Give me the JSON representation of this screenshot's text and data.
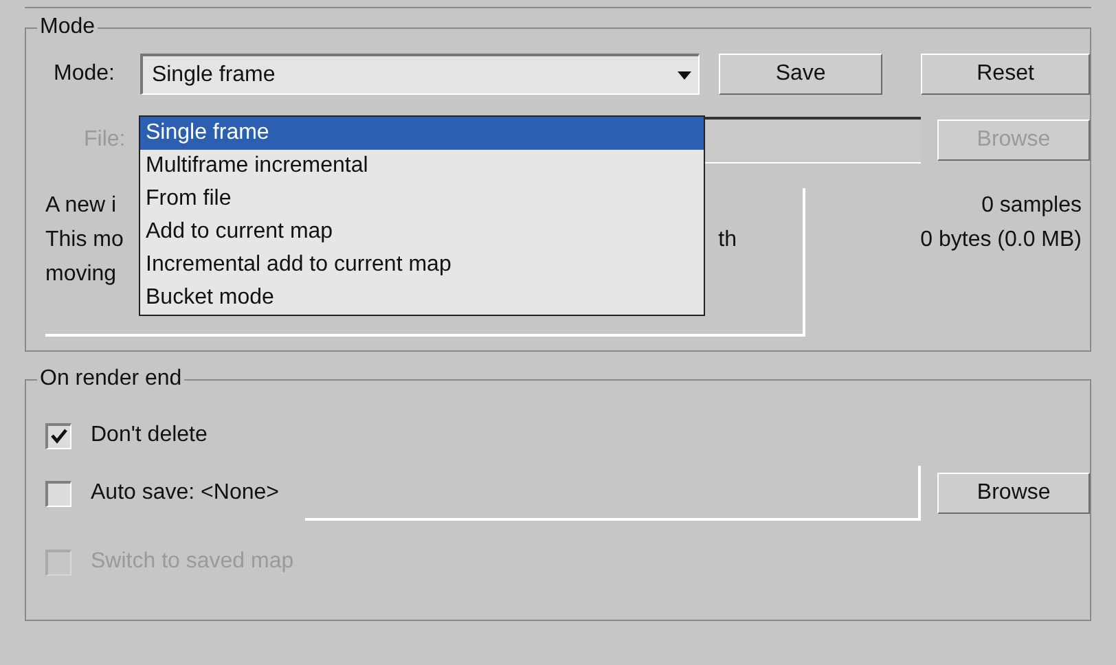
{
  "mode_group": {
    "title": "Mode",
    "mode_label": "Mode:",
    "mode_value": "Single frame",
    "save_button": "Save",
    "reset_button": "Reset",
    "file_label": "File:",
    "file_disabled": true,
    "browse_button": "Browse",
    "browse_disabled": true,
    "dropdown": {
      "options": [
        {
          "label": "Single frame",
          "selected": true
        },
        {
          "label": "Multiframe incremental",
          "selected": false
        },
        {
          "label": "From file",
          "selected": false
        },
        {
          "label": "Add to current map",
          "selected": false
        },
        {
          "label": "Incremental add to current map",
          "selected": false
        },
        {
          "label": "Bucket mode",
          "selected": false
        }
      ]
    },
    "description": [
      {
        "start": "A new i"
      },
      {
        "start": "This mo",
        "end": "th"
      },
      {
        "start": "moving"
      }
    ],
    "samples": "0 samples",
    "bytes": "0 bytes (0.0 MB)"
  },
  "render_end_group": {
    "title": "On render end",
    "options": [
      {
        "kind": "checkbox",
        "label": "Don't delete",
        "checked": true,
        "disabled": false
      },
      {
        "kind": "file",
        "label": "Auto save: <None>",
        "checked": false,
        "disabled": false,
        "button": "Browse"
      },
      {
        "kind": "checkbox",
        "label": "Switch to saved map",
        "checked": false,
        "disabled": true
      }
    ]
  }
}
